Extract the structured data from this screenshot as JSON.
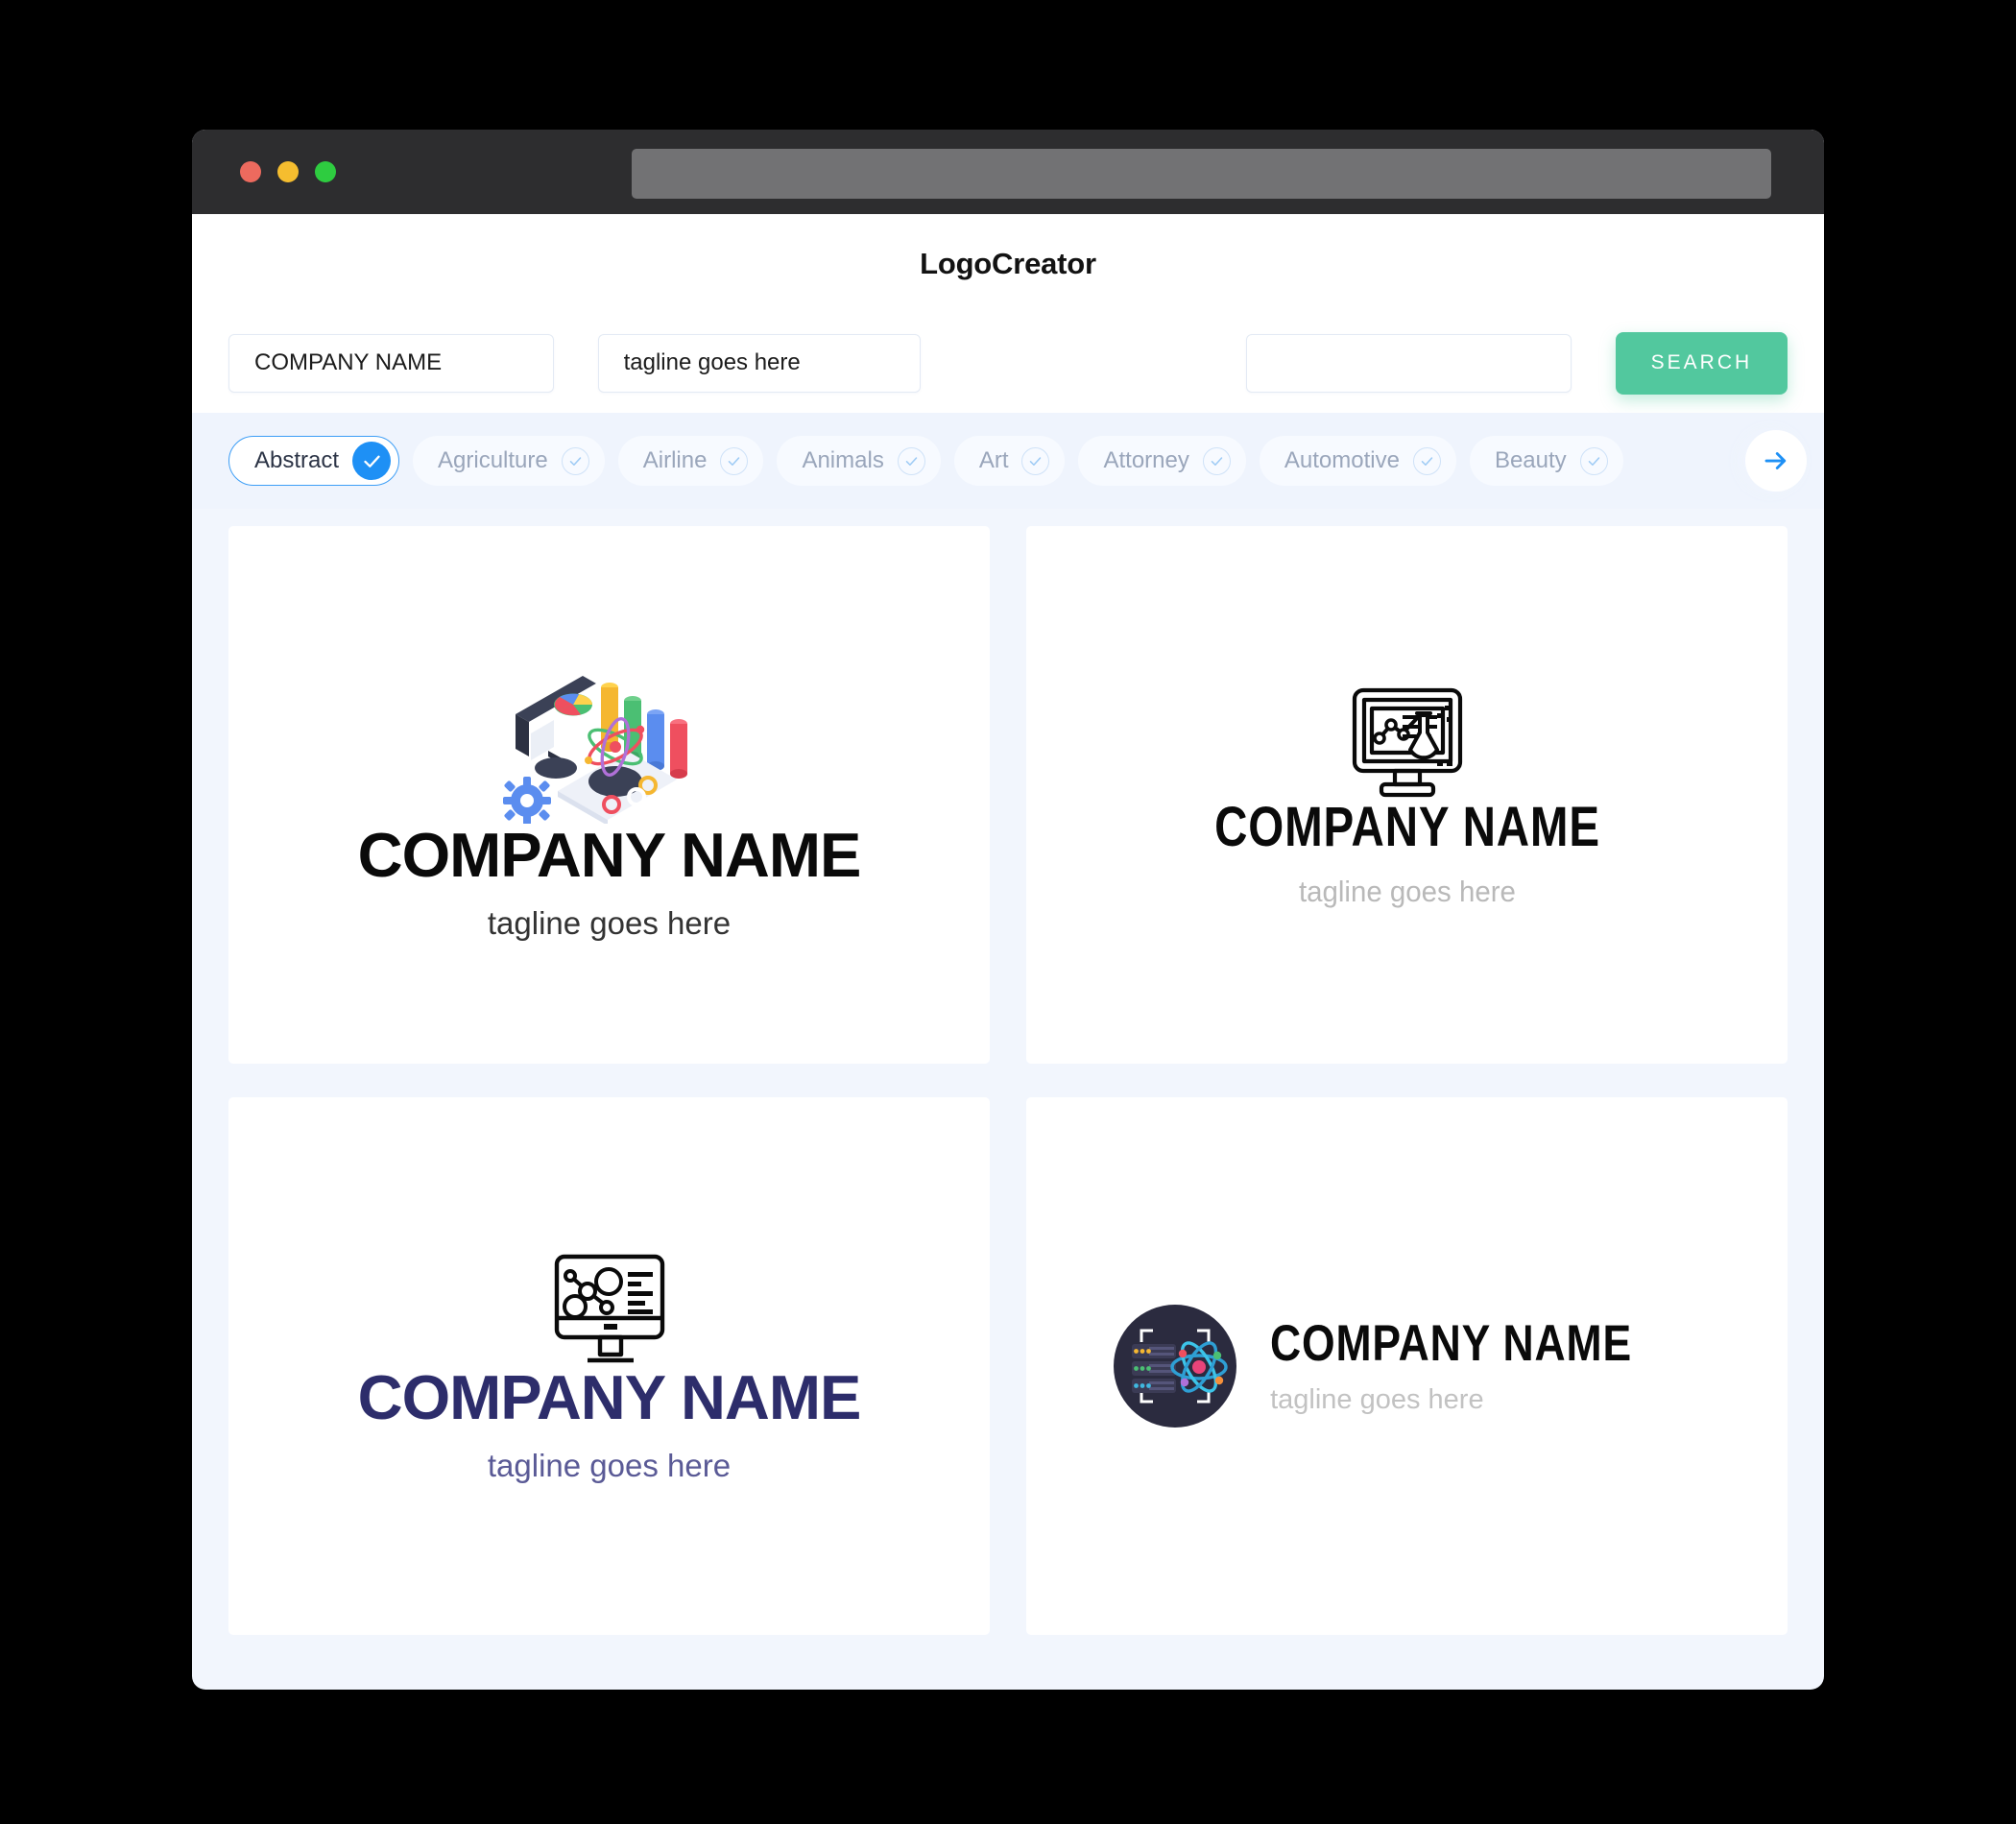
{
  "window": {
    "titlebar": {
      "lights": [
        "close-red",
        "minimize-yellow",
        "maximize-green"
      ],
      "url_value": ""
    }
  },
  "header": {
    "title": "LogoCreator"
  },
  "search": {
    "company_value": "COMPANY NAME",
    "company_placeholder": "COMPANY NAME",
    "tagline_value": "tagline goes here",
    "tagline_placeholder": "tagline goes here",
    "extra_value": "",
    "extra_placeholder": "",
    "button_label": "SEARCH",
    "button_color": "#52c89e"
  },
  "categories": {
    "next_icon": "arrow-right-icon",
    "items": [
      {
        "label": "Abstract",
        "selected": true
      },
      {
        "label": "Agriculture",
        "selected": false
      },
      {
        "label": "Airline",
        "selected": false
      },
      {
        "label": "Animals",
        "selected": false
      },
      {
        "label": "Art",
        "selected": false
      },
      {
        "label": "Attorney",
        "selected": false
      },
      {
        "label": "Automotive",
        "selected": false
      },
      {
        "label": "Beauty",
        "selected": false
      }
    ],
    "active_color": "#1e90f5"
  },
  "results": [
    {
      "icon": "isometric-data-science-illustration",
      "title": "COMPANY NAME",
      "tagline": "tagline goes here",
      "title_color": "#0a0a0a",
      "tagline_color": "#333333",
      "layout": "stacked"
    },
    {
      "icon": "monitor-lab-flask-icon",
      "title": "COMPANY NAME",
      "tagline": "tagline goes here",
      "title_color": "#0a0a0a",
      "tagline_color": "#b9b9b9",
      "layout": "stacked"
    },
    {
      "icon": "monitor-molecule-network-icon",
      "title": "COMPANY NAME",
      "tagline": "tagline goes here",
      "title_color": "#2d2d6b",
      "tagline_color": "#5a5a96",
      "layout": "stacked"
    },
    {
      "icon": "circle-server-atom-icon",
      "title": "COMPANY NAME",
      "tagline": "tagline goes here",
      "title_color": "#0a0a0a",
      "tagline_color": "#c2c2c2",
      "layout": "horizontal"
    }
  ]
}
